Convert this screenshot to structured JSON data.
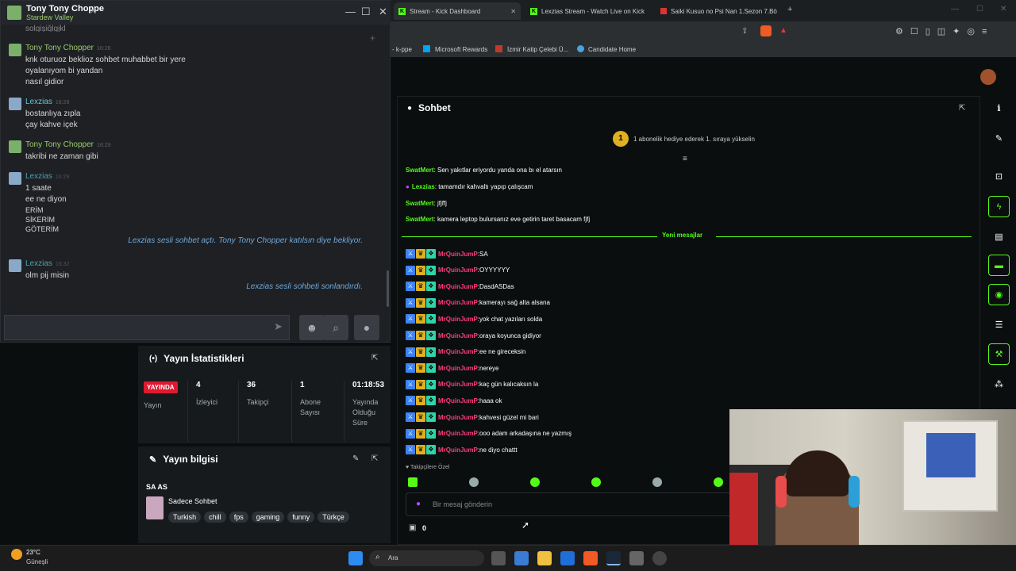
{
  "steam": {
    "contact_name": "Tony Tony Choppe",
    "contact_game": "Stardew Valley",
    "window_controls": [
      "—",
      "☐",
      "✕"
    ],
    "partial_top_line": "solgişiğlgjkl",
    "messages": [
      {
        "name": "Tony Tony Chopper",
        "time": "16:26",
        "lines": [
          "knk oturuoz beklioz sohbet muhabbet bir yere",
          "oyalanıyom bi yandan",
          "nasıl gidior"
        ]
      },
      {
        "name": "Lexzias",
        "time": "16:28",
        "lines": [
          "bostanlıya zıpla",
          "çay kahve içek"
        ]
      },
      {
        "name": "Tony Tony Chopper",
        "time": "16:29",
        "lines": [
          "takribi ne zaman gibi"
        ]
      },
      {
        "name": "Lexzias",
        "time": "16:29",
        "lines": [
          "1 saate",
          "ee ne diyon",
          "ERİM",
          "SİKERİM",
          "GÖTERİM"
        ]
      },
      {
        "name": "Lexzias",
        "time": "16:32",
        "lines": [
          "olm pij misin"
        ]
      }
    ],
    "system_messages": [
      "Lexzias sesli sohbet açtı. Tony Tony Chopper katılsın diye bekliyor.",
      "Lexzias sesli sohbeti sonlandırdı."
    ]
  },
  "stats": {
    "title": "Yayın İstatistikleri",
    "live_badge": "YAYINDA",
    "live_label": "Yayın",
    "columns": [
      {
        "value": "4",
        "label": "İzleyici"
      },
      {
        "value": "36",
        "label": "Takipçi"
      },
      {
        "value": "1",
        "label": "Abone Sayısı"
      },
      {
        "value": "01:18:53",
        "label": "Yayında Olduğu Süre"
      }
    ]
  },
  "info": {
    "title": "Yayın bilgisi",
    "stream_title": "SA AS",
    "category": "Sadece Sohbet",
    "tags": [
      "Turkish",
      "chill",
      "fps",
      "gaming",
      "funny",
      "Türkçe"
    ]
  },
  "browser": {
    "tabs": [
      "Stream - Kick Dashboard",
      "Lexzias Stream - Watch Live on Kick",
      "Saiki Kusuo no Psi Nan 1.Sezon 7.Bö"
    ],
    "bookmarks": [
      "- k-ppe",
      "Microsoft Rewards",
      "İzmir Katip Çelebi Ü...",
      "Candidate Home"
    ]
  },
  "kick": {
    "chat_title": "Sohbet",
    "pinned": "1 abonelik hediye ederek 1. sıraya yükselin",
    "pinned_rank": "1",
    "old_messages": [
      {
        "user": "SwatMert",
        "color": "#53fc18",
        "text": "Sen yakıtlar eriyordu yanda ona bı el atarsın"
      },
      {
        "user": "Lexzias",
        "color": "#53fc18",
        "text": "tamamdır kahvaltı yapıp çalışcam"
      },
      {
        "user": "SwatMert",
        "color": "#53fc18",
        "text": "jfjffj"
      },
      {
        "user": "SwatMert",
        "color": "#53fc18",
        "text": "kamera leptop bulursanız eve getirin taret basacam fjfj"
      }
    ],
    "new_messages_label": "Yeni mesajlar",
    "new_user": "MrQuinJumP",
    "new_user_color": "#ff3b7a",
    "new_messages": [
      "SA",
      "OYYYYYY",
      "DasdASDas",
      "kamerayı sağ alta alsana",
      "yok chat yazıları solda",
      "oraya koyunca gidiyor",
      "ee ne gireceksin",
      "nereye",
      "kaç gün kalıcaksın la",
      "haaa ok",
      "kahvesi güzel mi bari",
      "ooo adam arkadaşına ne yazmış",
      "ne diyo chattt"
    ],
    "followers_only": "Takipçilere Özel",
    "input_placeholder": "Bir mesaj gönderin",
    "points": "0"
  },
  "taskbar": {
    "weather_temp": "23°C",
    "weather_desc": "Güneşli",
    "search_label": "Ara"
  }
}
